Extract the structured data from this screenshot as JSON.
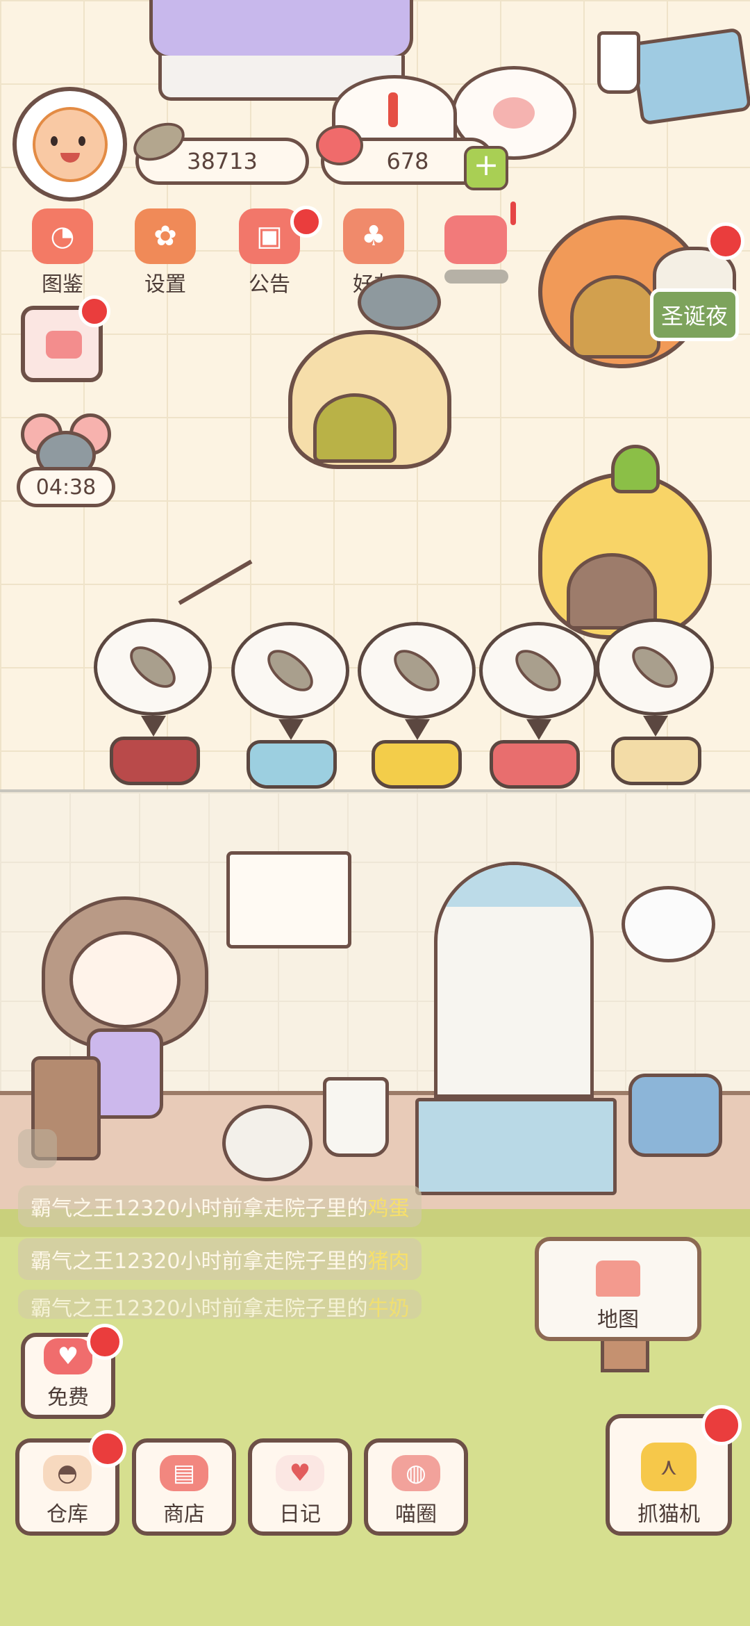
{
  "currency": {
    "fish_count": "38713",
    "heart_count": "678"
  },
  "menu": {
    "items": [
      {
        "label": "图鉴",
        "icon": "cat-head-icon",
        "color": "#f37a65"
      },
      {
        "label": "设置",
        "icon": "gear-icon",
        "color": "#f08a58"
      },
      {
        "label": "公告",
        "icon": "gift-icon",
        "color": "#f2776a"
      },
      {
        "label": "好友",
        "icon": "friends-icon",
        "color": "#f08a6b"
      }
    ]
  },
  "timer": {
    "value": "04:38"
  },
  "event": {
    "label": "圣诞夜",
    "color": "#7da35c"
  },
  "feed": {
    "bowls": [
      {
        "color": "#b94a4a"
      },
      {
        "color": "#9ccfe0"
      },
      {
        "color": "#f3cd4a"
      },
      {
        "color": "#e86e6e"
      },
      {
        "color": "#f3dca7"
      }
    ]
  },
  "notices": [
    {
      "user": "霸气之王123",
      "middle": "20小时前拿走院子里的",
      "item": "鸡蛋"
    },
    {
      "user": "霸气之王123",
      "middle": "20小时前拿走院子里的",
      "item": "猪肉"
    },
    {
      "user": "霸气之王123",
      "middle": "20小时前拿走院子里的",
      "item": "牛奶"
    }
  ],
  "buttons": {
    "free": "免费",
    "map": "地图",
    "warehouse": "仓库",
    "shop": "商店",
    "diary": "日记",
    "circle": "喵圈",
    "claw": "抓猫机"
  },
  "colors": {
    "outline": "#6d5047",
    "badge": "#ea3d3d",
    "notice_item": "#f7e06a"
  }
}
